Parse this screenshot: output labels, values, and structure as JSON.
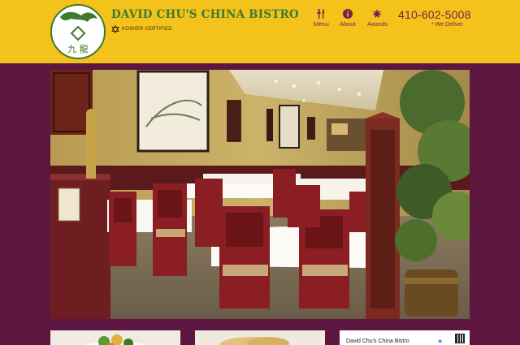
{
  "header": {
    "brand_name": "DAVID CHU'S CHINA BISTRO",
    "logo_glyphs": "九 龍",
    "kosher_label": "KOSHER CERTIFIED",
    "phone": "410-602-5008",
    "delivery_note": "* We Deliver",
    "nav": [
      {
        "label": "Menu",
        "icon": "fork-knife-icon"
      },
      {
        "label": "About",
        "icon": "info-icon"
      },
      {
        "label": "Awards",
        "icon": "award-starburst-icon"
      }
    ]
  },
  "cards": {
    "map_label": "David Chu's China Bistro"
  },
  "colors": {
    "header_bg": "#f3c21b",
    "page_bg": "#5c1640",
    "brand_green": "#3f7a2e",
    "accent_plum": "#7a2050"
  }
}
